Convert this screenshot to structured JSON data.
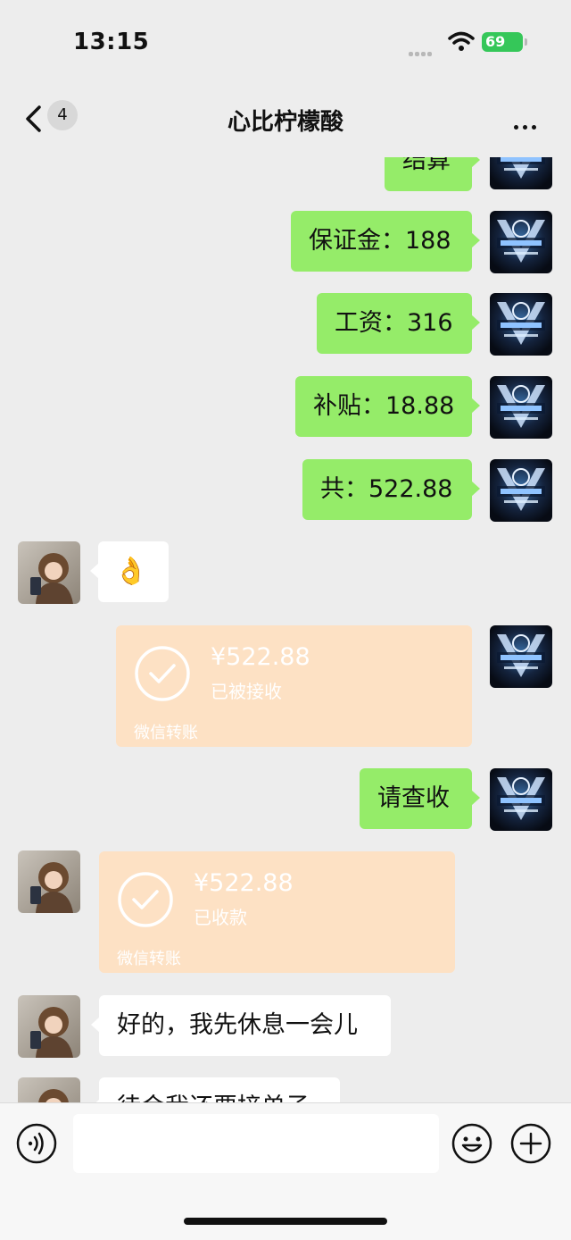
{
  "status_bar": {
    "time": "13:15",
    "battery": "69"
  },
  "header": {
    "unread_count": "4",
    "title": "心比柠檬酸"
  },
  "messages": {
    "m0": {
      "text": "结算"
    },
    "m1": {
      "text": "保证金：188"
    },
    "m2": {
      "text": "工资：316"
    },
    "m3": {
      "text": "补贴：18.88"
    },
    "m4": {
      "text": "共：522.88"
    },
    "m5": {
      "text": "👌"
    },
    "m6": {
      "amount": "¥522.88",
      "status": "已被接收",
      "label": "微信转账"
    },
    "m7": {
      "text": "请查收"
    },
    "m8": {
      "amount": "¥522.88",
      "status": "已收款",
      "label": "微信转账"
    },
    "m9": {
      "text": "好的，我先休息一会儿"
    },
    "m10": {
      "text": "待会我还要接单子"
    }
  },
  "colors": {
    "self_bubble": "#95ec69",
    "other_bubble": "#ffffff",
    "transfer": "#fde1c4",
    "background": "#ededed"
  },
  "icons": [
    "back-icon",
    "more-icon",
    "voice-icon",
    "emoji-icon",
    "plus-icon",
    "check-icon"
  ]
}
